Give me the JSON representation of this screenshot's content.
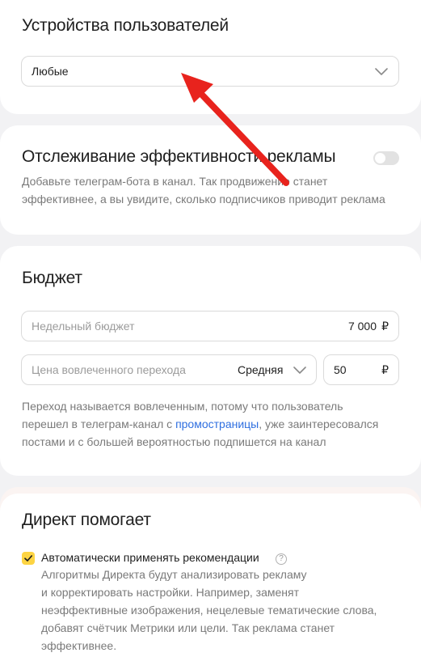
{
  "devices": {
    "title": "Устройства пользователей",
    "select_value": "Любые"
  },
  "tracking": {
    "title": "Отслеживание эффективности рекламы",
    "desc_line1": "Добавьте телеграм-бота в канал. Так продвижение станет",
    "desc_line2": "эффективнее, а вы увидите, сколько подписчиков приводит реклама",
    "toggle_on": false
  },
  "budget": {
    "title": "Бюджет",
    "weekly_placeholder": "Недельный бюджет",
    "weekly_value": "7 000",
    "currency": "₽",
    "cpc_placeholder": "Цена вовлеченного перехода",
    "cpc_mode": "Средняя",
    "cpc_value": "50",
    "note_line1": "Переход называется вовлеченным, потому что пользователь",
    "note_line2_a": "перешел в телеграм-канал с ",
    "note_line2_link": "промостраницы",
    "note_line2_b": ", уже заинтересовался",
    "note_line3": "постами и с большей вероятностью подпишется на канал"
  },
  "direct": {
    "title": "Директ помогает",
    "checkbox_label": "Автоматически применять рекомендации",
    "checkbox_checked": true,
    "help_glyph": "?",
    "desc_line1": "Алгоритмы Директа будут анализировать рекламу",
    "desc_line2": "и корректировать настройки. Например, заменят",
    "desc_line3": "неэффективные изображения, нецелевые тематические слова,",
    "desc_line4": "добавят счётчик Метрики или цели. Так реклама станет",
    "desc_line5": "эффективнее."
  },
  "colors": {
    "accent_yellow": "#fdd443",
    "link_blue": "#2f6fe0",
    "arrow_red": "#e8231d"
  }
}
